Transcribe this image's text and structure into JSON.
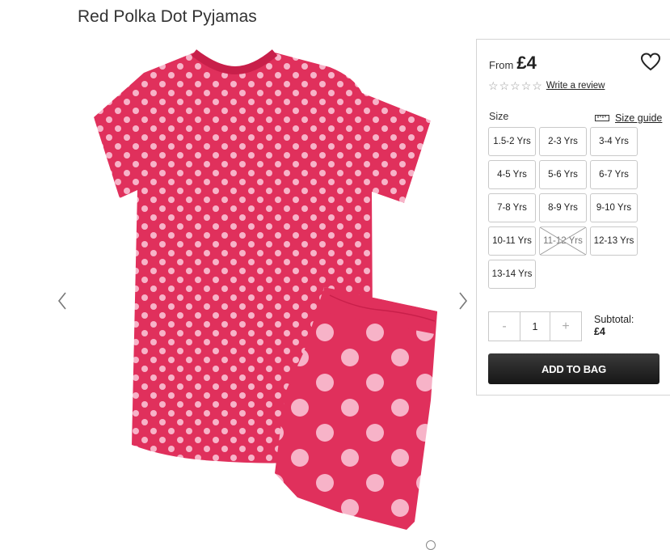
{
  "product": {
    "title": "Red Polka Dot Pyjamas",
    "image_name": "red-polka-dot-pyjamas"
  },
  "gallery": {
    "prev_icon": "chevron-left-icon",
    "next_icon": "chevron-right-icon"
  },
  "purchase": {
    "from_label": "From",
    "price": "£4",
    "wishlist_icon": "heart-icon",
    "rating": {
      "stars_total": 5,
      "stars_filled": 0,
      "write_review": "Write a review"
    },
    "size_label": "Size",
    "size_guide": "Size guide",
    "sizes": [
      {
        "label": "1.5-2 Yrs",
        "available": true
      },
      {
        "label": "2-3 Yrs",
        "available": true
      },
      {
        "label": "3-4 Yrs",
        "available": true
      },
      {
        "label": "4-5 Yrs",
        "available": true
      },
      {
        "label": "5-6 Yrs",
        "available": true
      },
      {
        "label": "6-7 Yrs",
        "available": true
      },
      {
        "label": "7-8 Yrs",
        "available": true
      },
      {
        "label": "8-9 Yrs",
        "available": true
      },
      {
        "label": "9-10 Yrs",
        "available": true
      },
      {
        "label": "10-11 Yrs",
        "available": true
      },
      {
        "label": "11-12 Yrs",
        "available": false
      },
      {
        "label": "12-13 Yrs",
        "available": true
      },
      {
        "label": "13-14 Yrs",
        "available": true
      }
    ],
    "quantity": {
      "minus": "-",
      "value": "1",
      "plus": "+"
    },
    "subtotal_label": "Subtotal:",
    "subtotal_value": "£4",
    "add_to_bag": "ADD TO BAG"
  },
  "colors": {
    "pyjama_red": "#e0305c",
    "dot_pink": "#f7b3c8",
    "button_dark": "#222222"
  }
}
